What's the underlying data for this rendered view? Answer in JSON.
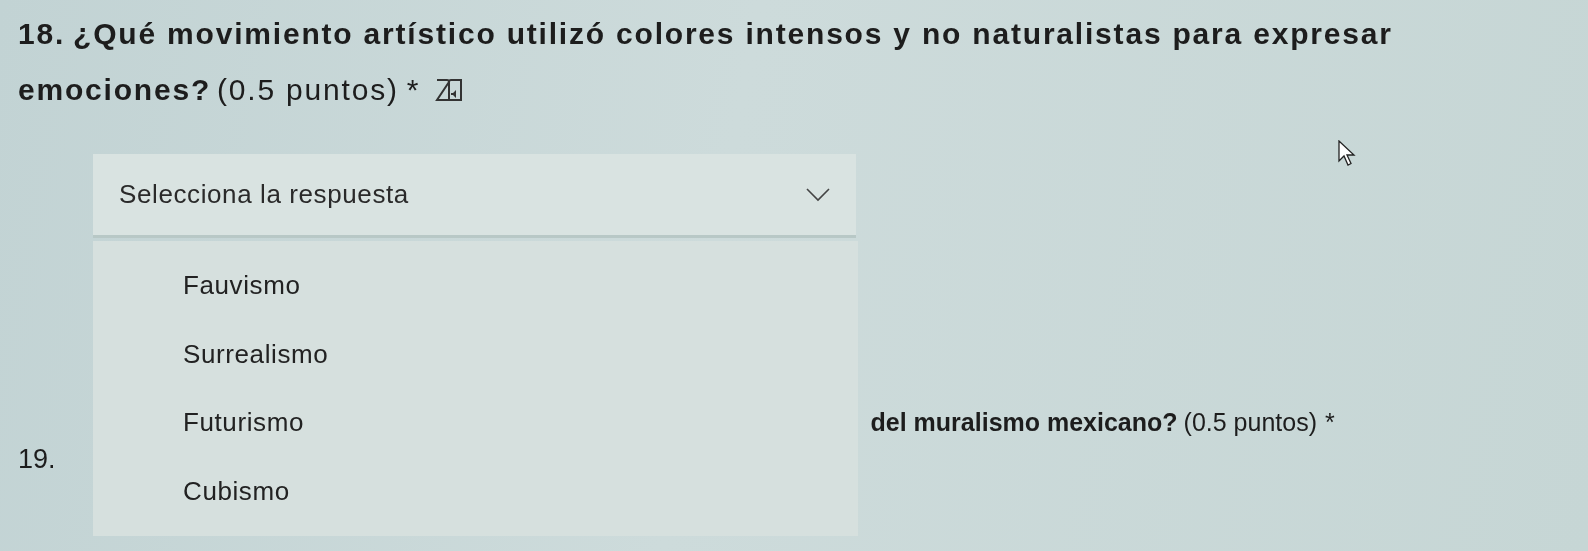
{
  "question_18": {
    "number": "18.",
    "title_lines": [
      "¿Qué movimiento artístico utilizó colores intensos y no naturalistas para expresar",
      "emociones?"
    ],
    "points": "(0.5 puntos)",
    "required_mark": "*"
  },
  "dropdown": {
    "placeholder": "Selecciona la respuesta",
    "expanded": true,
    "options": [
      {
        "label": "Fauvismo",
        "selected": false
      },
      {
        "label": "Surrealismo",
        "selected": false
      },
      {
        "label": "Futurismo",
        "selected": false
      },
      {
        "label": "Cubismo",
        "selected": false
      }
    ]
  },
  "question_19": {
    "number": "19.",
    "title": "del muralismo mexicano?",
    "points": "(0.5 puntos)",
    "required_mark": "*"
  }
}
